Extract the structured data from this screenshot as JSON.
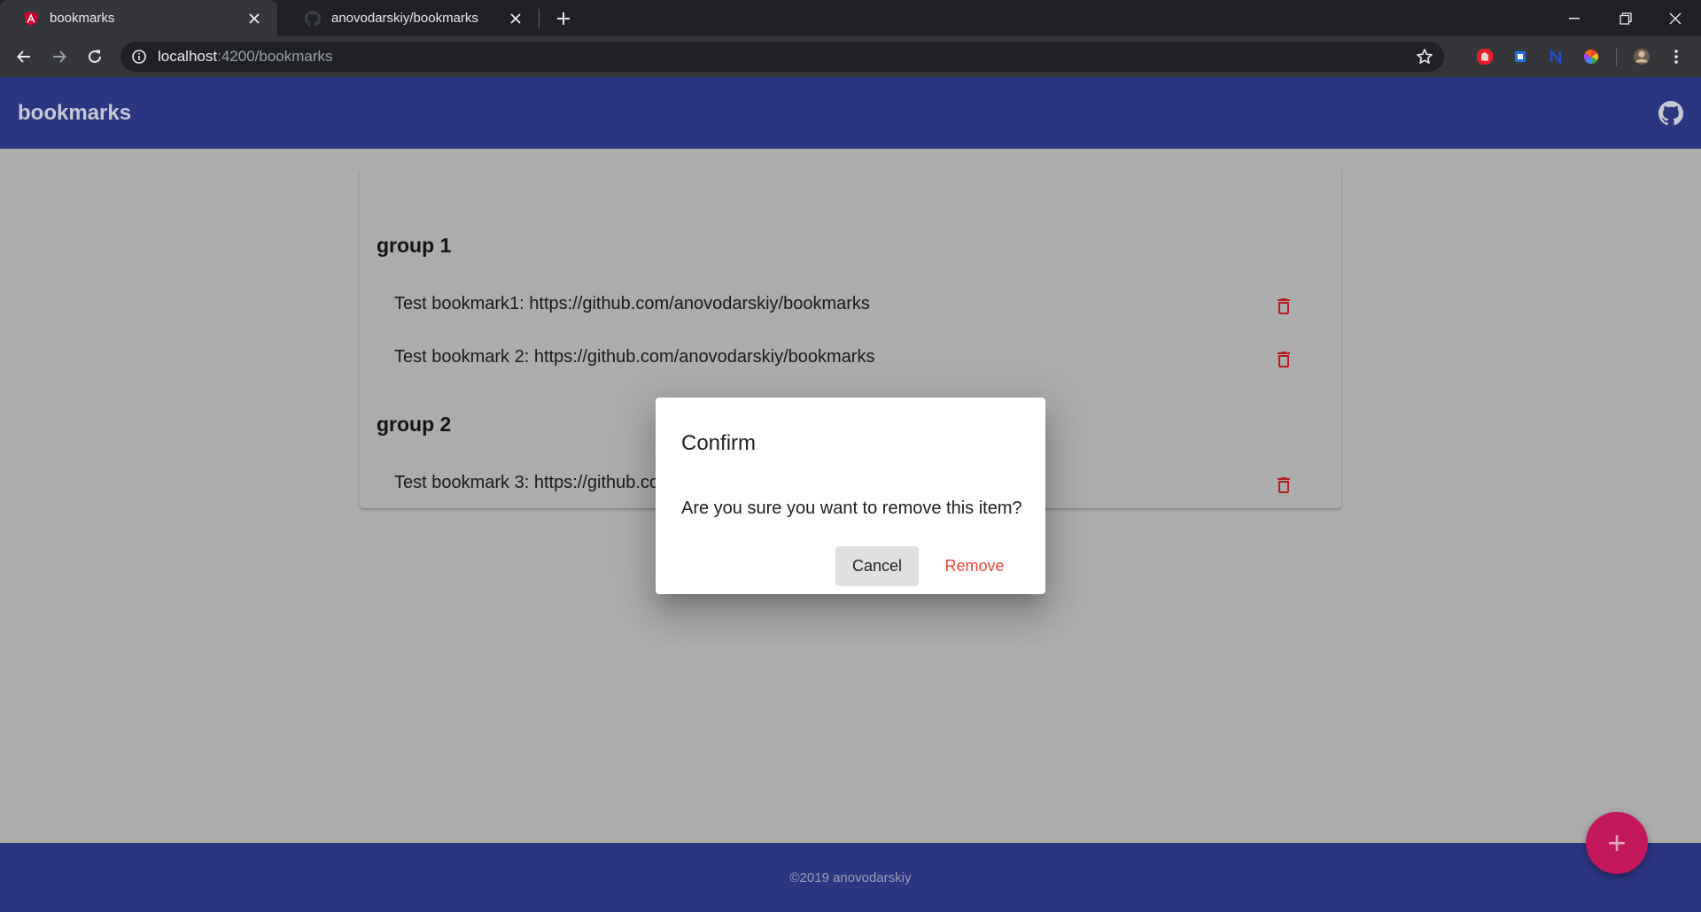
{
  "browser": {
    "tabs": [
      {
        "title": "bookmarks",
        "icon": "angular-icon",
        "active": true
      },
      {
        "title": "anovodarskiy/bookmarks",
        "icon": "github-icon",
        "active": false
      }
    ],
    "url": {
      "host": "localhost",
      "path": ":4200/bookmarks"
    },
    "extensions": [
      "adblock-icon",
      "extension-blue-icon",
      "extension-n-icon",
      "color-wheel-icon"
    ]
  },
  "app": {
    "title": "bookmarks",
    "github_icon": "github-icon"
  },
  "groups": [
    {
      "title": "group 1",
      "items": [
        {
          "text": "Test bookmark1: https://github.com/anovodarskiy/bookmarks"
        },
        {
          "text": "Test bookmark 2: https://github.com/anovodarskiy/bookmarks"
        }
      ]
    },
    {
      "title": "group 2",
      "items": [
        {
          "text": "Test bookmark 3: https://github.com/anovodarskiy/bookmarks"
        }
      ]
    }
  ],
  "dialog": {
    "title": "Confirm",
    "message": "Are you sure you want to remove this item?",
    "cancel_label": "Cancel",
    "remove_label": "Remove"
  },
  "footer": {
    "text": "©2019 anovodarskiy"
  },
  "fab": {
    "label": "+"
  },
  "colors": {
    "primary": "#2b3680",
    "accent": "#c2185b",
    "warn": "#f44336",
    "backdrop": "#acacac"
  }
}
